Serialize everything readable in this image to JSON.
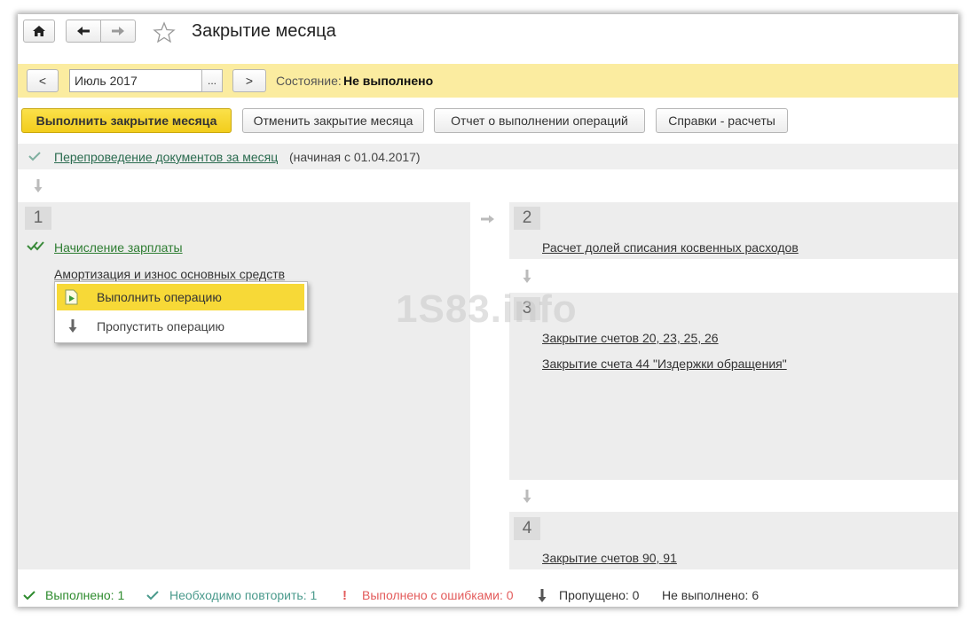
{
  "window": {
    "title": "Закрытие месяца",
    "home_icon": "home-icon",
    "back_icon": "arrow-left-icon",
    "forward_icon": "arrow-right-icon",
    "favorite_icon": "star-icon"
  },
  "period": {
    "prev_label": "<",
    "value": "Июль 2017",
    "select_label": "...",
    "next_label": ">",
    "state_label": "Состояние:",
    "state_value": "Не выполнено"
  },
  "toolbar": {
    "run_label": "Выполнить закрытие месяца",
    "cancel_label": "Отменить закрытие месяца",
    "report_label": "Отчет о выполнении операций",
    "refs_label": "Справки - расчеты"
  },
  "repost": {
    "link": "Перепроведение документов за месяц",
    "note": "(начиная с 01.04.2017)"
  },
  "steps": {
    "s1": {
      "number": "1",
      "items": [
        "Начисление зарплаты",
        "Амортизация и износ основных средств"
      ]
    },
    "s2": {
      "number": "2",
      "items": [
        "Расчет долей списания косвенных расходов"
      ]
    },
    "s3": {
      "number": "3",
      "items": [
        "Закрытие счетов 20, 23, 25, 26",
        "Закрытие счета 44 \"Издержки обращения\""
      ]
    },
    "s4": {
      "number": "4",
      "items": [
        "Закрытие счетов 90, 91"
      ]
    }
  },
  "context_menu": {
    "items": [
      {
        "label": "Выполнить операцию",
        "icon": "run-document-icon"
      },
      {
        "label": "Пропустить операцию",
        "icon": "arrow-down-icon"
      }
    ]
  },
  "watermark": "1S83.info",
  "status": {
    "done": "Выполнено: 1",
    "repeat": "Необходимо повторить: 1",
    "errors": "Выполнено с ошибками: 0",
    "skipped": "Пропущено: 0",
    "not_done": "Не выполнено: 6"
  },
  "colors": {
    "accent_yellow": "#f7d937",
    "state_bar": "#fbeca0",
    "link_green": "#2a6b4f",
    "done_green": "#2e8b2e",
    "repeat_teal": "#4a9a8c",
    "error_red": "#e35b5b"
  }
}
